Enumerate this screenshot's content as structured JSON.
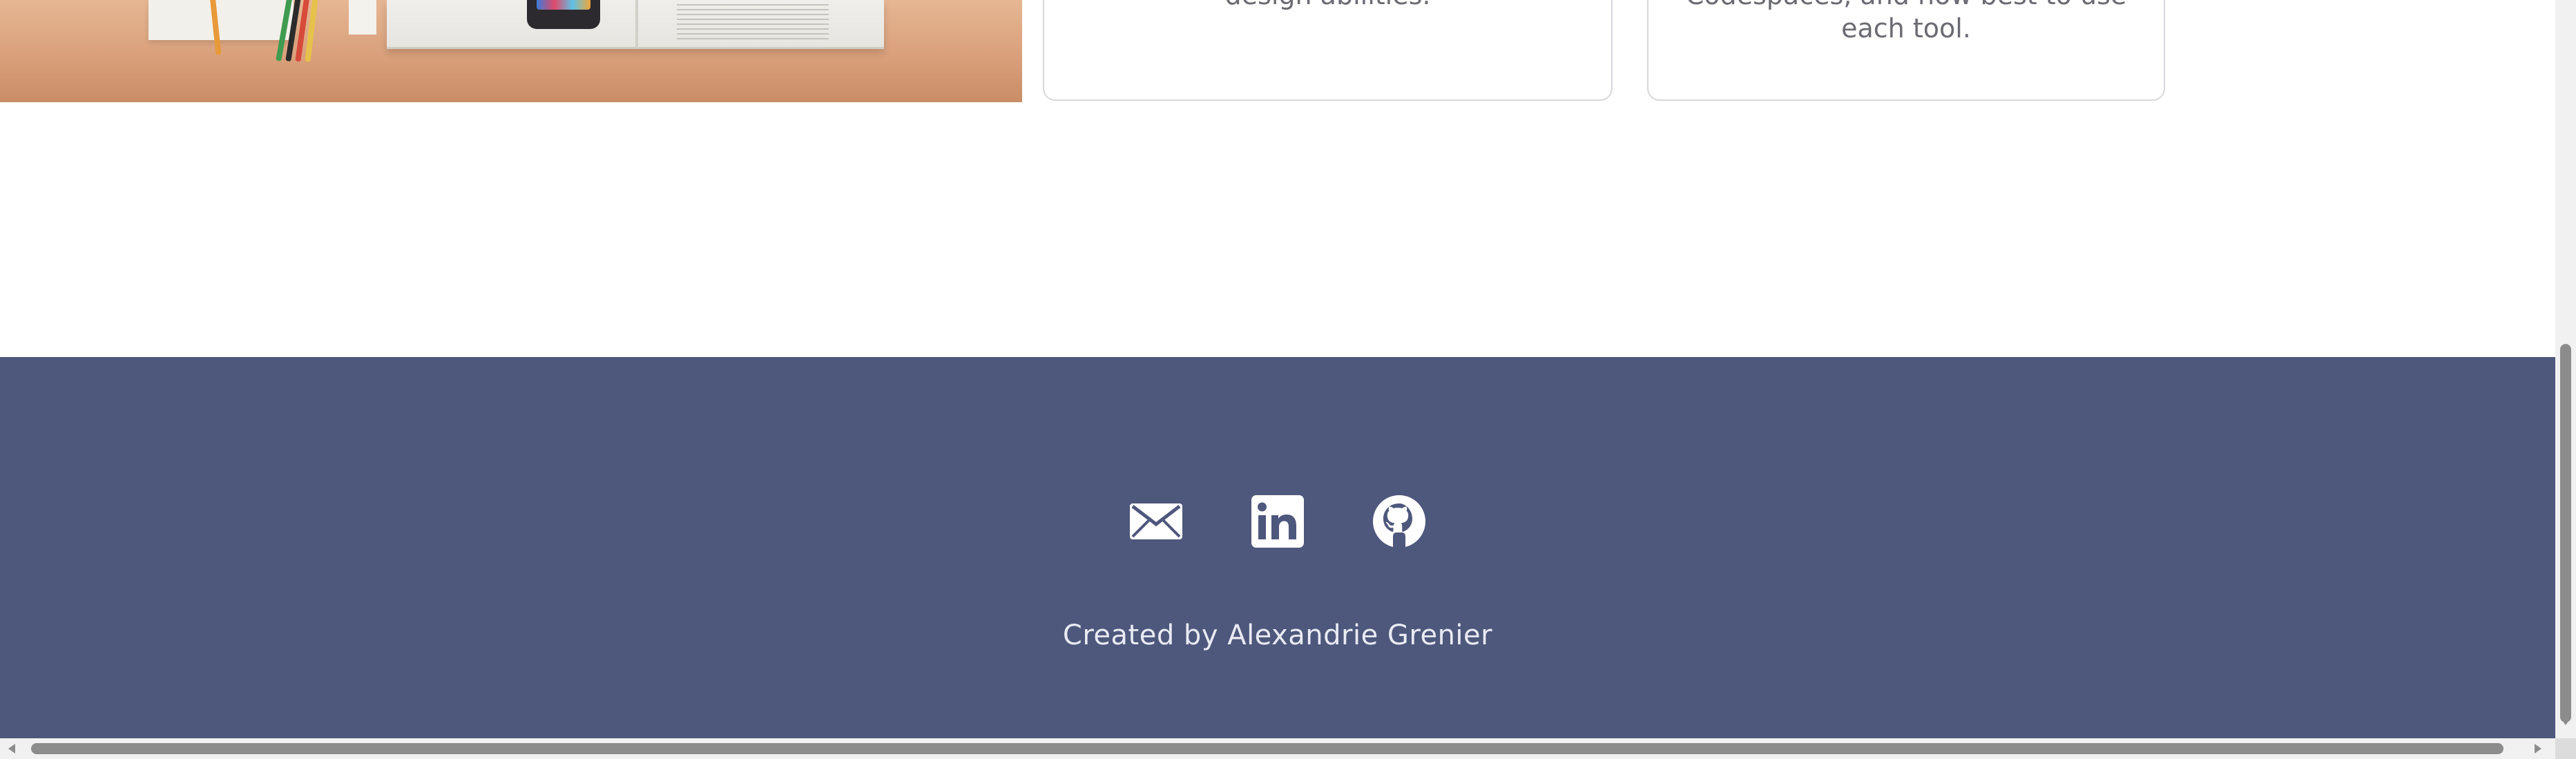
{
  "cards": [
    {
      "lines": [
        "design abilities."
      ]
    },
    {
      "lines": [
        "Codespaces, and how best to use",
        "each tool."
      ]
    }
  ],
  "footer": {
    "background_color": "#4e577c",
    "icons": [
      {
        "name": "email-icon"
      },
      {
        "name": "linkedin-icon"
      },
      {
        "name": "github-icon"
      }
    ],
    "credit": "Created by Alexandrie Grenier"
  }
}
